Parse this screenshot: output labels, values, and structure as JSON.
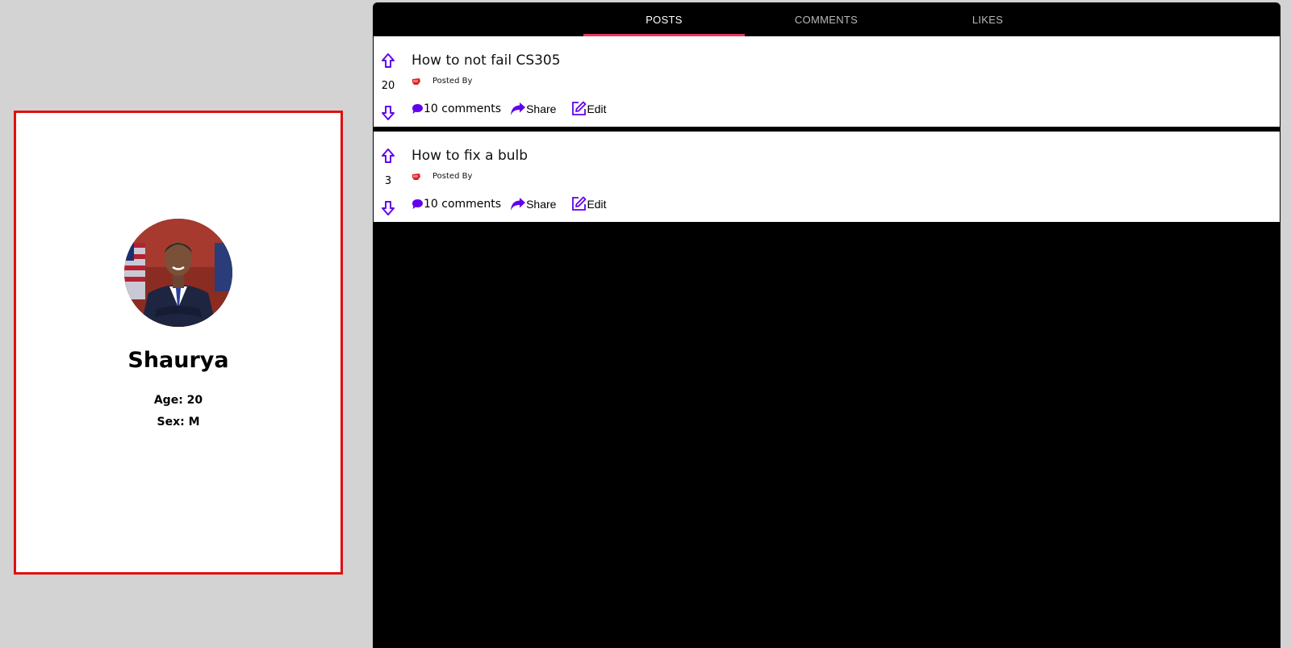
{
  "profile": {
    "name": "Shaurya",
    "age": "Age: 20",
    "sex": "Sex: M"
  },
  "tabs": [
    {
      "label": "POSTS",
      "active": true
    },
    {
      "label": "COMMENTS",
      "active": false
    },
    {
      "label": "LIKES",
      "active": false
    }
  ],
  "posts": [
    {
      "title": "How to not fail CS305",
      "votes": "20",
      "posted_by": "Posted By",
      "comments": "10 comments",
      "share": "Share",
      "edit": "Edit"
    },
    {
      "title": "How to fix a bulb",
      "votes": "3",
      "posted_by": "Posted By",
      "comments": "10 comments",
      "share": "Share",
      "edit": "Edit"
    }
  ],
  "colors": {
    "accent": "#6200ee",
    "tab_indicator": "#e8365e",
    "card_border": "#e01010",
    "fist": "#e02020"
  },
  "icons": [
    "arrow-up-icon",
    "arrow-down-icon",
    "comment-icon",
    "share-icon",
    "edit-icon",
    "fist-icon"
  ]
}
